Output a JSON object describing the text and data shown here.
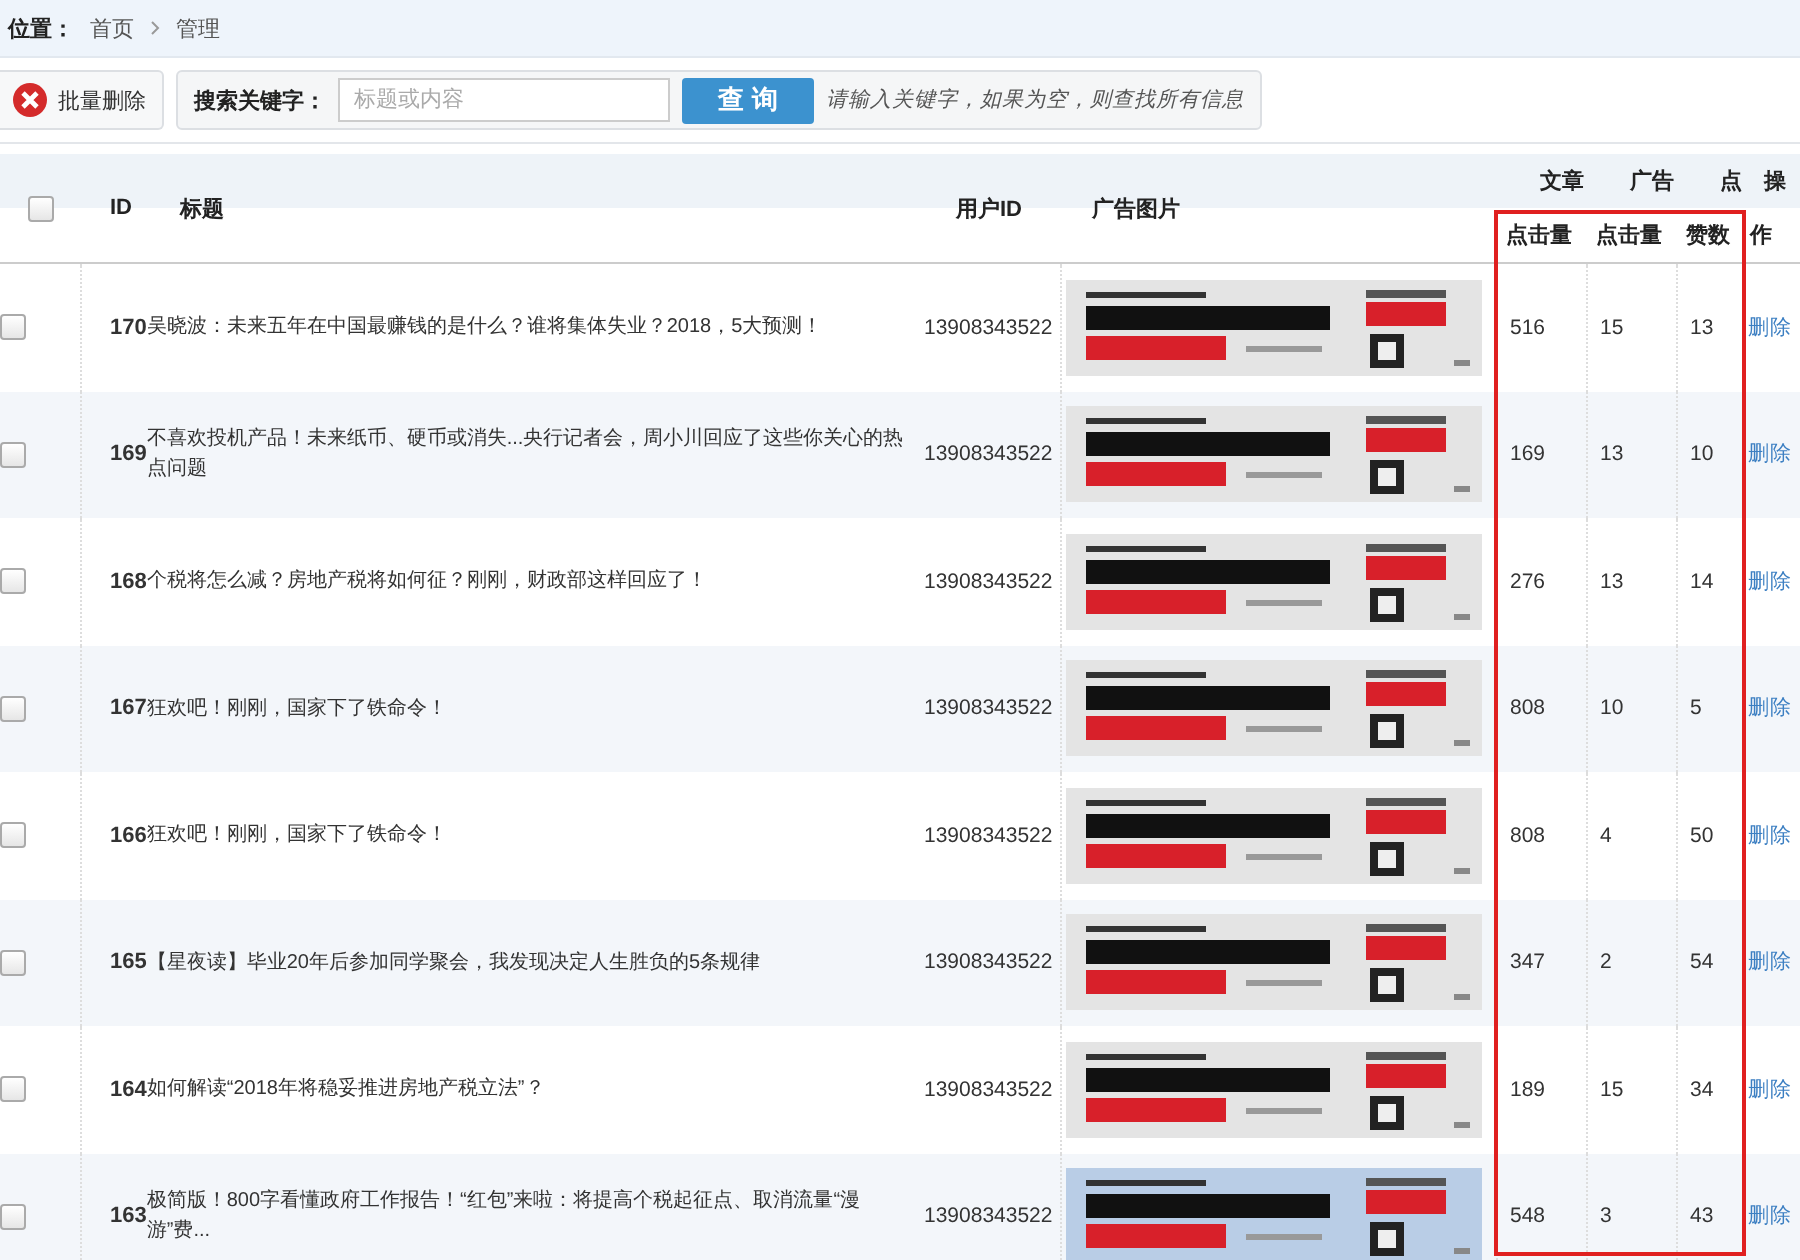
{
  "breadcrumb": {
    "label": "位置：",
    "items": [
      "首页",
      "管理"
    ]
  },
  "toolbar": {
    "batch_delete": "批量删除",
    "search_label": "搜索关键字：",
    "search": {
      "placeholder": "标题或内容"
    },
    "query_button": "查 询",
    "hint": "请输入关键字，如果为空，则查找所有信息"
  },
  "table": {
    "select_all": {
      "checked": false
    },
    "columns": [
      "ID",
      "标题",
      "用户ID",
      "广告图片"
    ],
    "groups": [
      {
        "top": "文章",
        "sub": "点击量"
      },
      {
        "top": "广告",
        "sub": "点击量"
      },
      {
        "top": "点",
        "sub": "赞数"
      },
      {
        "top": "操",
        "sub": "作"
      }
    ],
    "rows": [
      {
        "checked": false,
        "id": "170",
        "title": "吴晓波：未来五年在中国最赚钱的是什么？谁将集体失业？2018，5大预测！",
        "user_id": "13908343522",
        "article_clicks": "516",
        "ad_clicks": "15",
        "likes": "13",
        "action": "删除"
      },
      {
        "checked": false,
        "id": "169",
        "title": "不喜欢投机产品！未来纸币、硬币或消失...央行记者会，周小川回应了这些你关心的热点问题",
        "user_id": "13908343522",
        "article_clicks": "169",
        "ad_clicks": "13",
        "likes": "10",
        "action": "删除"
      },
      {
        "checked": false,
        "id": "168",
        "title": "个税将怎么减？房地产税将如何征？刚刚，财政部这样回应了！",
        "user_id": "13908343522",
        "article_clicks": "276",
        "ad_clicks": "13",
        "likes": "14",
        "action": "删除"
      },
      {
        "checked": false,
        "id": "167",
        "title": "狂欢吧！刚刚，国家下了铁命令！",
        "user_id": "13908343522",
        "article_clicks": "808",
        "ad_clicks": "10",
        "likes": "5",
        "action": "删除"
      },
      {
        "checked": false,
        "id": "166",
        "title": "狂欢吧！刚刚，国家下了铁命令！",
        "user_id": "13908343522",
        "article_clicks": "808",
        "ad_clicks": "4",
        "likes": "50",
        "action": "删除"
      },
      {
        "checked": false,
        "id": "165",
        "title": "【星夜读】毕业20年后参加同学聚会，我发现决定人生胜负的5条规律",
        "user_id": "13908343522",
        "article_clicks": "347",
        "ad_clicks": "2",
        "likes": "54",
        "action": "删除"
      },
      {
        "checked": false,
        "id": "164",
        "title": "如何解读“2018年将稳妥推进房地产税立法”？",
        "user_id": "13908343522",
        "article_clicks": "189",
        "ad_clicks": "15",
        "likes": "34",
        "action": "删除"
      },
      {
        "checked": false,
        "id": "163",
        "title": "极简版！800字看懂政府工作报告！“红包”来啦：将提高个税起征点、取消流量“漫游”费...",
        "user_id": "13908343522",
        "article_clicks": "548",
        "ad_clicks": "3",
        "likes": "43",
        "action": "删除"
      }
    ]
  }
}
